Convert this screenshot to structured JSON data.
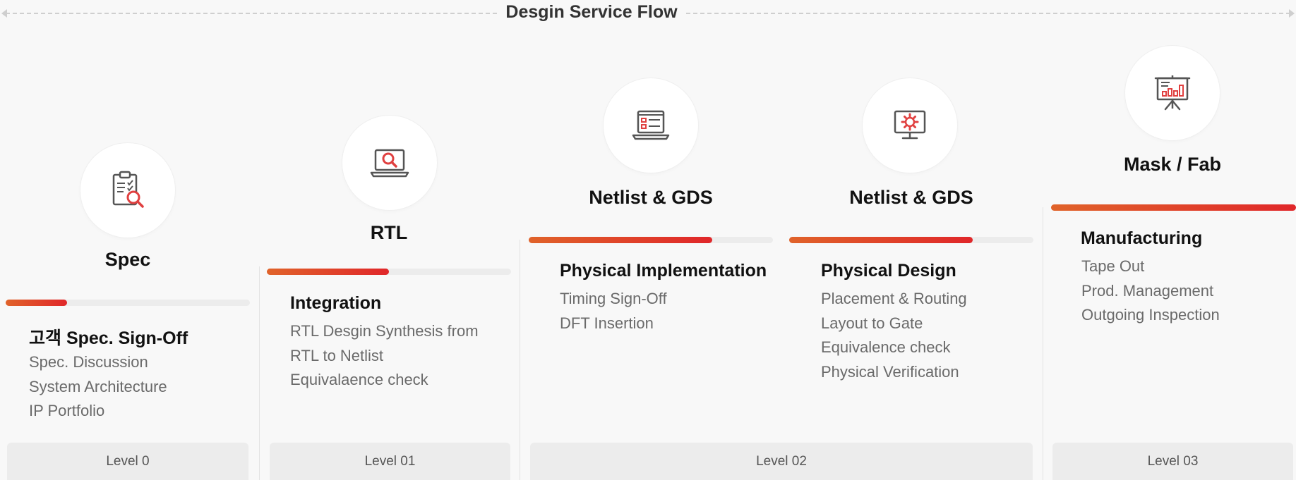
{
  "title": "Desgin Service Flow",
  "accent_gradient": [
    "#e0632a",
    "#e0272a"
  ],
  "icon_color": "#555555",
  "icon_accent": "#e04040",
  "stages": [
    {
      "title": "Spec",
      "icon": "clipboard-search-icon",
      "progress": 0.25,
      "subtitle": "고객 Spec. Sign-Off",
      "items": [
        "Spec. Discussion",
        "System Architecture",
        "IP Portfolio"
      ]
    },
    {
      "title": "RTL",
      "icon": "laptop-search-icon",
      "progress": 0.5,
      "subtitle": "Integration",
      "items": [
        "RTL Desgin Synthesis from",
        "RTL to Netlist",
        "Equivalaence check"
      ]
    },
    {
      "title": "Netlist & GDS",
      "icon": "laptop-document-icon",
      "progress": 0.75,
      "subtitle": "Physical Implementation",
      "items": [
        "Timing Sign-Off",
        "DFT Insertion"
      ]
    },
    {
      "title": "Netlist & GDS",
      "icon": "monitor-gear-icon",
      "progress": 0.75,
      "subtitle": "Physical Design",
      "items": [
        "Placement & Routing",
        "Layout to Gate",
        "Equivalence check",
        "Physical Verification"
      ]
    },
    {
      "title": "Mask / Fab",
      "icon": "presentation-chart-icon",
      "progress": 1.0,
      "subtitle": "Manufacturing",
      "items": [
        "Tape Out",
        "Prod. Management",
        "Outgoing Inspection"
      ]
    }
  ],
  "levels": [
    "Level 0",
    "Level 01",
    "Level 02",
    "Level 03"
  ]
}
